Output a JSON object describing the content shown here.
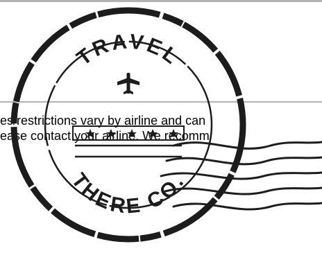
{
  "notice": {
    "line1": "es/restrictions vary by airline and can",
    "line2": "ease contact your airline. We recomm"
  },
  "stamp": {
    "top_text": "TRAVEL",
    "bottom_text": "THERE CO.",
    "icon": "airplane-icon",
    "color": "#1c1c1c"
  }
}
